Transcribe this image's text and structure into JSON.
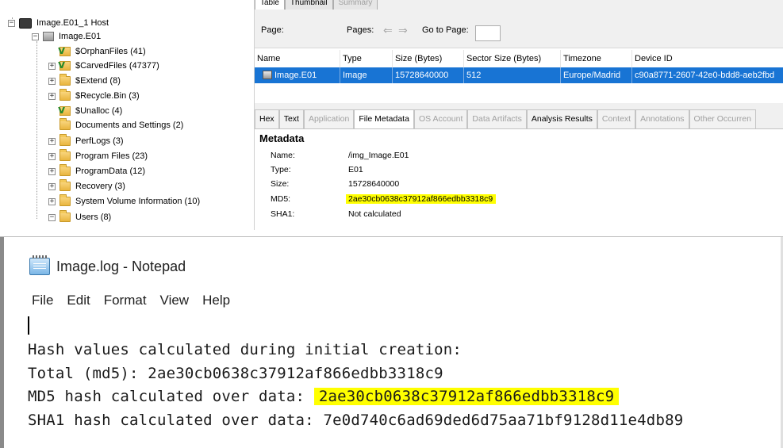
{
  "tree": {
    "host": "Image.E01_1 Host",
    "image": "Image.E01",
    "items": [
      {
        "label": "$OrphanFiles (41)",
        "expandable": false,
        "icon": "virtual-folder-icon"
      },
      {
        "label": "$CarvedFiles (47377)",
        "expandable": true,
        "icon": "virtual-folder-icon"
      },
      {
        "label": "$Extend (8)",
        "expandable": true,
        "icon": "folder-icon"
      },
      {
        "label": "$Recycle.Bin (3)",
        "expandable": true,
        "icon": "folder-icon"
      },
      {
        "label": "$Unalloc (4)",
        "expandable": false,
        "icon": "virtual-folder-icon"
      },
      {
        "label": "Documents and Settings (2)",
        "expandable": false,
        "icon": "folder-icon"
      },
      {
        "label": "PerfLogs (3)",
        "expandable": true,
        "icon": "folder-icon"
      },
      {
        "label": "Program Files (23)",
        "expandable": true,
        "icon": "folder-icon"
      },
      {
        "label": "ProgramData (12)",
        "expandable": true,
        "icon": "folder-icon"
      },
      {
        "label": "Recovery (3)",
        "expandable": true,
        "icon": "folder-icon"
      },
      {
        "label": "System Volume Information (10)",
        "expandable": true,
        "icon": "folder-icon"
      },
      {
        "label": "Users (8)",
        "expandable": true,
        "icon": "folder-icon"
      }
    ]
  },
  "results": {
    "top_tabs": [
      "Table",
      "Thumbnail",
      "Summary"
    ],
    "page_label": "Page:",
    "pages_label": "Pages:",
    "goto_label": "Go to Page:",
    "columns": [
      "Name",
      "Type",
      "Size (Bytes)",
      "Sector Size (Bytes)",
      "Timezone",
      "Device ID"
    ],
    "row": [
      "Image.E01",
      "Image",
      "15728640000",
      "512",
      "Europe/Madrid",
      "c90a8771-2607-42e0-bdd8-aeb2fbd"
    ]
  },
  "content_tabs": [
    "Hex",
    "Text",
    "Application",
    "File Metadata",
    "OS Account",
    "Data Artifacts",
    "Analysis Results",
    "Context",
    "Annotations",
    "Other Occurren"
  ],
  "metadata": {
    "title": "Metadata",
    "rows": [
      {
        "label": "Name:",
        "value": "/img_Image.E01"
      },
      {
        "label": "Type:",
        "value": "E01"
      },
      {
        "label": "Size:",
        "value": "15728640000"
      },
      {
        "label": "MD5:",
        "value": "2ae30cb0638c37912af866edbb3318c9"
      },
      {
        "label": "SHA1:",
        "value": "Not calculated"
      }
    ],
    "highlight_color": "#ffff00"
  },
  "notepad": {
    "title": "Image.log - Notepad",
    "menu": [
      "File",
      "Edit",
      "Format",
      "View",
      "Help"
    ],
    "lines": {
      "l1": "Hash values calculated during initial creation:",
      "l2": "Total (md5): 2ae30cb0638c37912af866edbb3318c9",
      "l3_prefix": "MD5 hash calculated over data:",
      "l3_hash": "2ae30cb0638c37912af866edbb3318c9",
      "l4": "SHA1 hash calculated over data: 7e0d740c6ad69ded6d75aa71bf9128d11e4db89"
    }
  },
  "colors": {
    "selection": "#1874d4",
    "highlight": "#ffff00"
  }
}
